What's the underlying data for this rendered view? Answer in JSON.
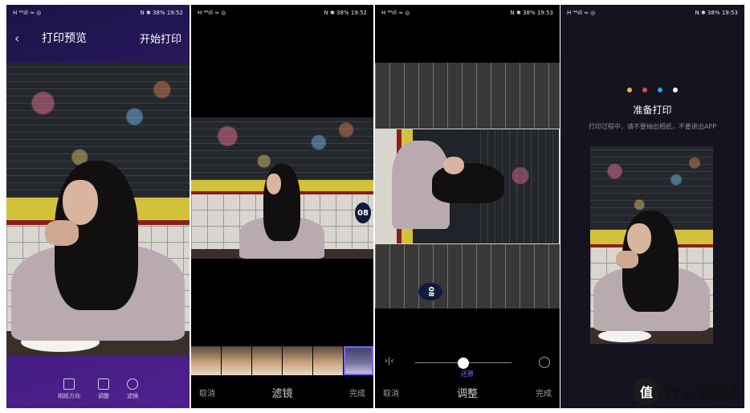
{
  "panel1": {
    "status": {
      "left": "H ⁴⁶ıll ≈ ◎",
      "right": "N ✱ 38% 19:52"
    },
    "back_icon": "back-arrow-icon",
    "title": "打印预览",
    "action": "开始打印",
    "tools": [
      {
        "label": "相纸方向",
        "icon": "paper-orientation-icon"
      },
      {
        "label": "调整",
        "icon": "adjust-icon"
      },
      {
        "label": "滤镜",
        "icon": "filter-icon"
      }
    ]
  },
  "panel2": {
    "status": {
      "left": "H ⁴⁶ıll ≈ ◎",
      "right": "N ✱ 38% 19:52"
    },
    "badge": "08",
    "cancel": "取消",
    "mode": "滤镜",
    "done": "完成"
  },
  "panel3": {
    "status": {
      "left": "H ⁴⁶ıll ≈ ◎",
      "right": "N ✱ 38% 19:53"
    },
    "mirror_icon": "mirror-flip-icon",
    "reset_icon": "rotate-reset-icon",
    "slider_value": 0.5,
    "restore": "还原",
    "cancel": "取消",
    "mode": "调整",
    "done": "完成",
    "badge": "08"
  },
  "panel4": {
    "status": {
      "left": "H ⁴⁶ıll ≈ ◎",
      "right": "N ✱ 38% 19:53"
    },
    "dot_colors": [
      "#f2b034",
      "#e5473c",
      "#2f9ff0",
      "#ffffff"
    ],
    "title": "准备打印",
    "subtitle": "打印过程中，请不要抽出相纸，不要退出APP"
  },
  "watermark": {
    "logo_char": "值",
    "text": "什么值得买"
  },
  "colors": {
    "accent": "#7c63ff",
    "panel1_bg": "#3a1c7a"
  }
}
